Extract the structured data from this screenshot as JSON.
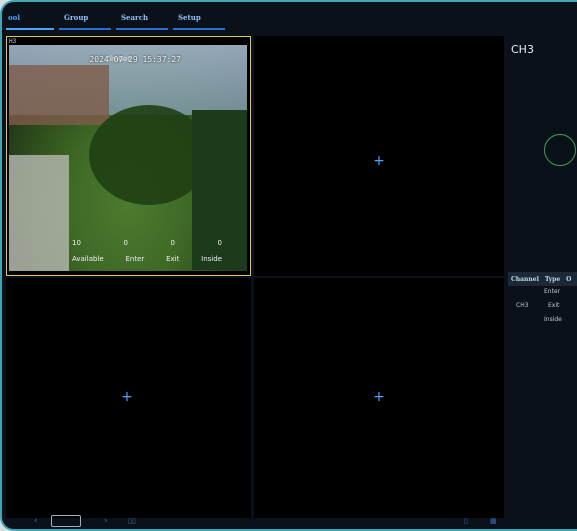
{
  "nav": {
    "tabs": [
      {
        "label": "ool"
      },
      {
        "label": "Group"
      },
      {
        "label": "Search"
      },
      {
        "label": "Setup"
      }
    ]
  },
  "video": {
    "active_channel_tag": "H3",
    "overlay_prefix": "Cimoon",
    "timestamp": "2024-07-29 15:37:27",
    "counts": {
      "values": [
        "10",
        "0",
        "0",
        "0"
      ],
      "labels": [
        "Available",
        "Enter",
        "Exit",
        "Inside"
      ]
    }
  },
  "side": {
    "title": "CH3",
    "table": {
      "headers": [
        "Channel",
        "Type",
        "O"
      ],
      "rows": [
        {
          "channel": "",
          "type": "Enter"
        },
        {
          "channel": "CH3",
          "type": "Exit"
        },
        {
          "channel": "",
          "type": "Inside"
        }
      ]
    }
  },
  "icons": {
    "plus": "+",
    "chevron_left": "‹",
    "chevron_right": "›"
  },
  "colors": {
    "accent": "#4aa3ff",
    "active_border": "#e0c64a",
    "frame": "#3fa6b6"
  }
}
